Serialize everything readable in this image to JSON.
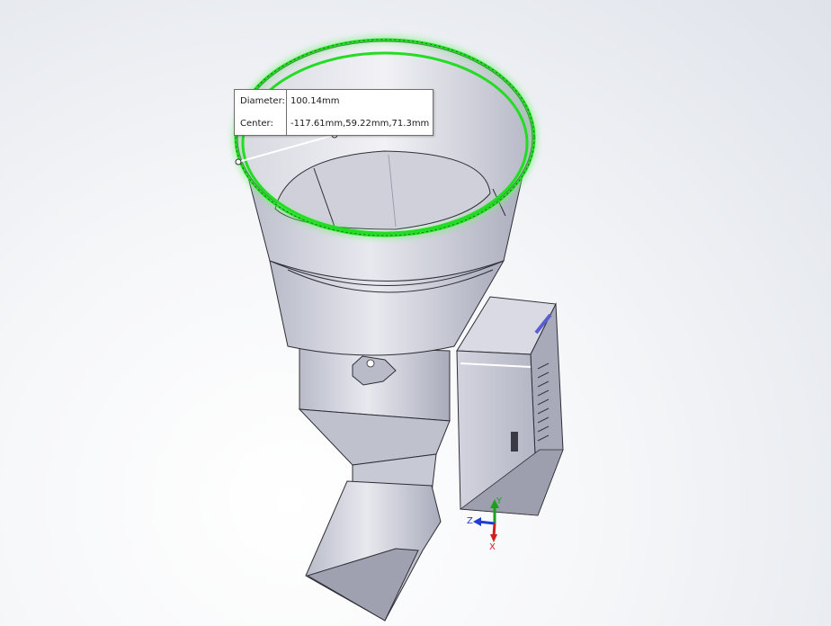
{
  "measurement": {
    "diameter_label": "Diameter:",
    "diameter_value": "100.14mm",
    "center_label": "Center:",
    "center_value": "-117.61mm,59.22mm,71.3mm"
  },
  "triad": {
    "y_label": "Y",
    "z_label": "Z",
    "x_label": "X",
    "y_color": "#1ea01e",
    "z_color": "#1f3fd0",
    "x_color": "#d01f1f"
  },
  "colors": {
    "selection_edge": "#22dd22",
    "part_body": "#c9cbd6"
  }
}
